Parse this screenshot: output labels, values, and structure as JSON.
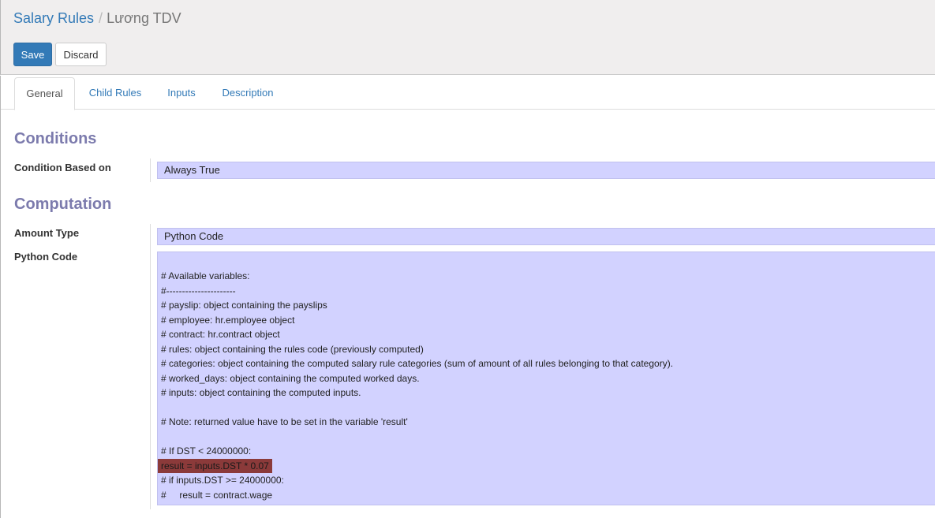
{
  "breadcrumb": {
    "parent": "Salary Rules",
    "separator": "/",
    "current": "Lương TDV"
  },
  "buttons": {
    "save": "Save",
    "discard": "Discard"
  },
  "tabs": [
    {
      "label": "General",
      "active": true
    },
    {
      "label": "Child Rules",
      "active": false
    },
    {
      "label": "Inputs",
      "active": false
    },
    {
      "label": "Description",
      "active": false
    }
  ],
  "sections": {
    "conditions": "Conditions",
    "computation": "Computation"
  },
  "fields": {
    "condition_based_on": {
      "label": "Condition Based on",
      "value": "Always True"
    },
    "amount_type": {
      "label": "Amount Type",
      "value": "Python Code"
    },
    "python_code": {
      "label": "Python Code",
      "lines": [
        "# Available variables:",
        "#----------------------",
        "# payslip: object containing the payslips",
        "# employee: hr.employee object",
        "# contract: hr.contract object",
        "# rules: object containing the rules code (previously computed)",
        "# categories: object containing the computed salary rule categories (sum of amount of all rules belonging to that category).",
        "# worked_days: object containing the computed worked days.",
        "# inputs: object containing the computed inputs.",
        "",
        "# Note: returned value have to be set in the variable 'result'",
        "",
        "# If DST < 24000000:",
        "result = inputs.DST * 0.07",
        "# if inputs.DST >= 24000000:",
        "#     result = contract.wage"
      ],
      "highlighted_line": 13
    }
  },
  "colors": {
    "accent": "#337ab7",
    "section_title": "#7c7bad",
    "field_bg": "#d2d2ff",
    "highlight": "#8b3a3a"
  }
}
